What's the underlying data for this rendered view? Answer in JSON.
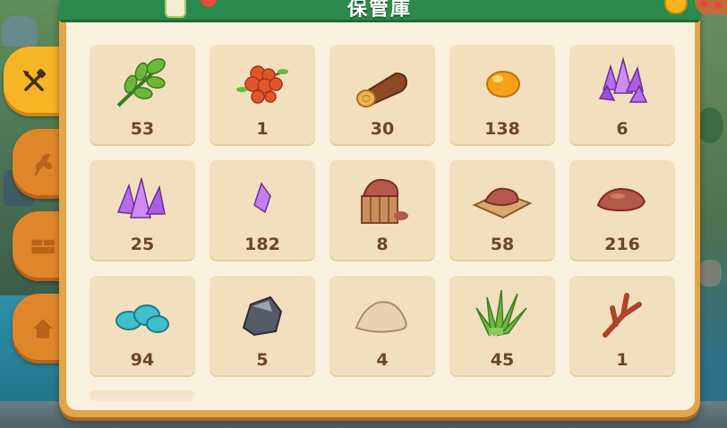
{
  "title": "保管庫",
  "tabs": [
    {
      "name": "tab-tools",
      "icon": "hammer-shovel-icon",
      "active": true
    },
    {
      "name": "tab-crops",
      "icon": "wheat-icon",
      "active": false
    },
    {
      "name": "tab-bricks",
      "icon": "brick-icon",
      "active": false
    },
    {
      "name": "tab-decor",
      "icon": "house-icon",
      "active": false
    }
  ],
  "items": [
    {
      "icon": "leaf-sprig-icon",
      "count": "53"
    },
    {
      "icon": "berries-icon",
      "count": "1"
    },
    {
      "icon": "wood-log-icon",
      "count": "30"
    },
    {
      "icon": "amber-drop-icon",
      "count": "138"
    },
    {
      "icon": "purple-crystal-cluster-icon",
      "count": "6"
    },
    {
      "icon": "purple-crystals-icon",
      "count": "25"
    },
    {
      "icon": "purple-shard-icon",
      "count": "182"
    },
    {
      "icon": "clay-crate-icon",
      "count": "8"
    },
    {
      "icon": "clay-slab-icon",
      "count": "58"
    },
    {
      "icon": "clay-pile-icon",
      "count": "216"
    },
    {
      "icon": "blue-ore-icon",
      "count": "94"
    },
    {
      "icon": "coal-rock-icon",
      "count": "5"
    },
    {
      "icon": "sand-pile-icon",
      "count": "4"
    },
    {
      "icon": "grass-bundle-icon",
      "count": "45"
    },
    {
      "icon": "coral-branch-icon",
      "count": "1"
    }
  ],
  "colors": {
    "header_green": "#2b8a4c",
    "panel_cream": "#fbf1df",
    "slot_beige": "#f2dfbe",
    "count_brown": "#6b4727",
    "tab_active": "#f6b524",
    "tab_inactive": "#e0862a"
  }
}
